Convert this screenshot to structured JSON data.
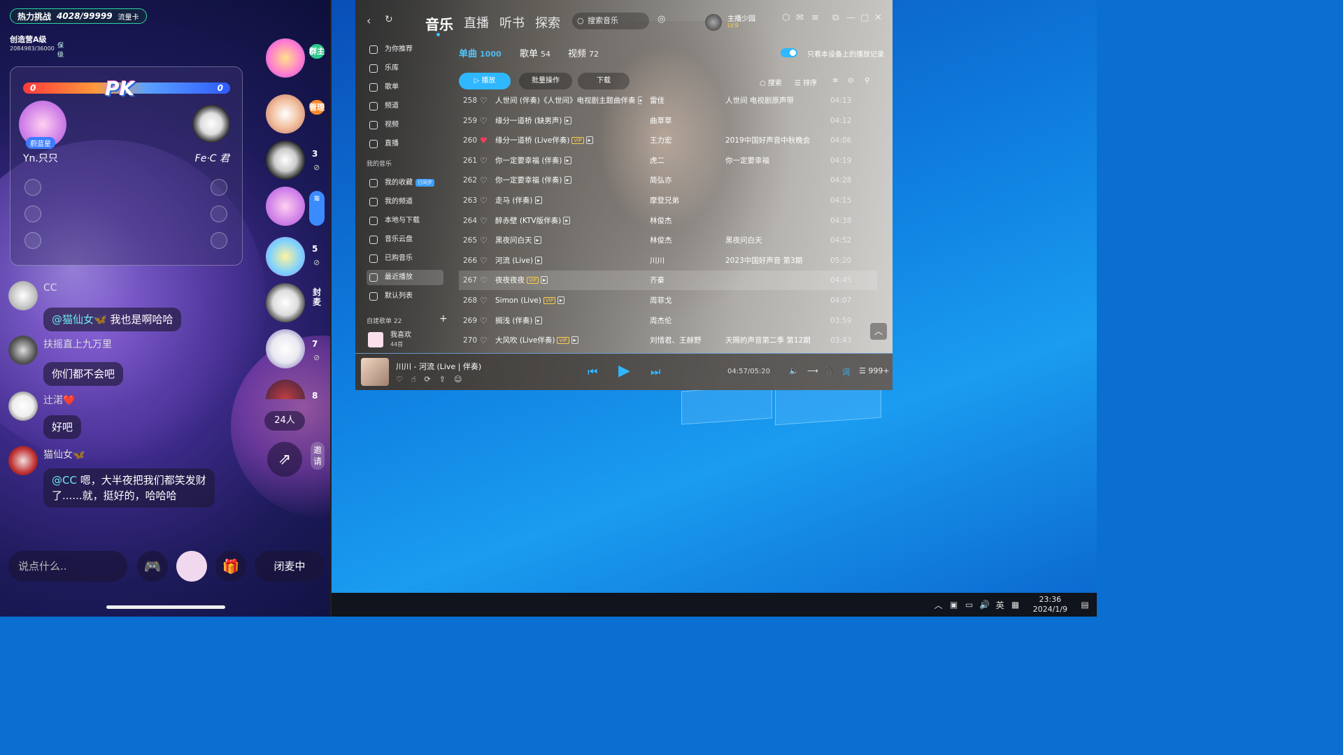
{
  "live": {
    "heat_label": "热力挑战",
    "heat_value": "4028/99999",
    "heat_tag": "流量卡",
    "camp_title": "创造营A级",
    "camp_sub": "2084983/36000",
    "camp_badge": "保级",
    "pk_left_score": "0",
    "pk_right_score": "0",
    "pk_logo": "PK",
    "pk_badge": "蔚蓝星",
    "pk_left_name": "Yn.只只",
    "pk_right_name": "Fe·C 君",
    "side_tag_1": "群主",
    "side_tag_2": "管理",
    "side_num_3": "3",
    "side_num_5": "5",
    "side_tag_6": "封麦",
    "side_num_7": "7",
    "side_num_8": "8",
    "online_count": "24人",
    "invite_label": "邀请",
    "messages": [
      {
        "name": "CC",
        "text_at": "@猫仙女🦋",
        "text": " 我也是啊哈哈"
      },
      {
        "name": "扶摇直上九万里",
        "text_at": "",
        "text": "你们都不会吧"
      },
      {
        "name": "辻渃❤️",
        "text_at": "",
        "text": "好吧"
      },
      {
        "name": "猫仙女🦋",
        "text_at": "@CC",
        "text": " 嗯，大半夜把我们都笑发财",
        "text2": "了......就，挺好的，哈哈哈"
      }
    ],
    "input_placeholder": "说点什么..",
    "mic_label": "闭麦中"
  },
  "music": {
    "tabs": [
      "音乐",
      "直播",
      "听书",
      "探索"
    ],
    "search_placeholder": "搜索音乐",
    "user_name": "主播少园",
    "user_level": "LV.9",
    "sidebar": [
      {
        "label": "为你推荐"
      },
      {
        "label": "乐库"
      },
      {
        "label": "歌单"
      },
      {
        "label": "频道"
      },
      {
        "label": "视频"
      },
      {
        "label": "直播"
      }
    ],
    "sidebar_head_my": "我的音乐",
    "sidebar_my": [
      {
        "label": "我的收藏",
        "badge": "已同步"
      },
      {
        "label": "我的频道"
      },
      {
        "label": "本地与下载"
      },
      {
        "label": "音乐云盘"
      },
      {
        "label": "已购音乐"
      },
      {
        "label": "最近播放"
      },
      {
        "label": "默认列表"
      }
    ],
    "sidebar_head_created": "自建歌单 22",
    "sidebar_fav": "我喜欢",
    "sidebar_fav_count": "44首",
    "subtabs": [
      {
        "label": "单曲",
        "count": "1000"
      },
      {
        "label": "歌单",
        "count": "54"
      },
      {
        "label": "视频",
        "count": "72"
      }
    ],
    "toggle_label": "只看本设备上的播放记录",
    "btn_play": "▷ 播放",
    "btn_batch": "批量操作",
    "btn_download": "下载",
    "tool_search": "搜索",
    "tool_sort": "排序",
    "rows": [
      {
        "no": "258",
        "title": "人世间 (伴奏)《人世间》电视剧主题曲伴奏",
        "artist": "雷佳",
        "album": "人世间 电视剧原声带",
        "dur": "04:13",
        "vip": false,
        "liked": false
      },
      {
        "no": "259",
        "title": "缘分一道桥 (缺男声)",
        "artist": "曲草草",
        "album": "",
        "dur": "04:12",
        "vip": false,
        "liked": false
      },
      {
        "no": "260",
        "title": "缘分一道桥 (Live伴奏)",
        "artist": "王力宏",
        "album": "2019中国好声音中秋晚会",
        "dur": "04:06",
        "vip": true,
        "liked": true
      },
      {
        "no": "261",
        "title": "你一定要幸福 (伴奏)",
        "artist": "虎二",
        "album": "你一定要幸福",
        "dur": "04:19",
        "vip": false,
        "liked": false
      },
      {
        "no": "262",
        "title": "你一定要幸福 (伴奏)",
        "artist": "简弘亦",
        "album": "",
        "dur": "04:28",
        "vip": false,
        "liked": false
      },
      {
        "no": "263",
        "title": "走马 (伴奏)",
        "artist": "摩登兄弟",
        "album": "",
        "dur": "04:15",
        "vip": false,
        "liked": false
      },
      {
        "no": "264",
        "title": "醉赤壁 (KTV版伴奏)",
        "artist": "林俊杰",
        "album": "",
        "dur": "04:38",
        "vip": false,
        "liked": false
      },
      {
        "no": "265",
        "title": "黑夜问白天",
        "artist": "林俊杰",
        "album": "黑夜问白天",
        "dur": "04:52",
        "vip": false,
        "liked": false
      },
      {
        "no": "266",
        "title": "河流 (Live)",
        "artist": "川川",
        "album": "2023中国好声音 第3期",
        "dur": "05:20",
        "vip": false,
        "liked": false
      },
      {
        "no": "267",
        "title": "夜夜夜夜",
        "artist": "齐秦",
        "album": "",
        "dur": "04:45",
        "vip": true,
        "liked": false
      },
      {
        "no": "268",
        "title": "Simon (Live)",
        "artist": "周菲戈",
        "album": "",
        "dur": "04:07",
        "vip": true,
        "liked": false
      },
      {
        "no": "269",
        "title": "搁浅 (伴奏)",
        "artist": "周杰伦",
        "album": "",
        "dur": "03:59",
        "vip": false,
        "liked": false
      },
      {
        "no": "270",
        "title": "大风吹 (Live伴奏)",
        "artist": "刘惜君、王赫野",
        "album": "天赐的声音第二季 第12期",
        "dur": "03:43",
        "vip": true,
        "liked": false
      }
    ],
    "now_playing": "川川 - 河流 (Live | 伴奏)",
    "time": "04:57/05:20",
    "playlist_count": "999+"
  },
  "taskbar": {
    "ime": "英",
    "time": "23:36",
    "date": "2024/1/9"
  }
}
